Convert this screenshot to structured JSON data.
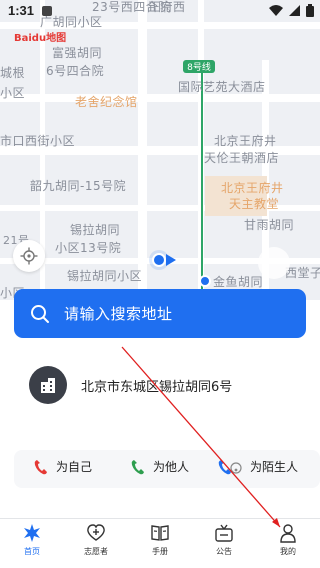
{
  "status_bar": {
    "time": "1:31"
  },
  "map": {
    "labels": {
      "l1": "23号西四合院",
      "l2": "正府西",
      "l3": "广胡同小区",
      "l4": "富强胡同",
      "l5": "6号四合院",
      "l6": "城根",
      "l7": "小区",
      "l8": "老舍纪念馆",
      "l9": "国际艺苑大酒店",
      "l10": "市口西街小区",
      "l11": "北京王府井",
      "l12": "天伦王朝酒店",
      "l13": "北京王府井",
      "l14": "天主教堂",
      "l15": "韶九胡同-15号院",
      "l16": "甘雨胡同",
      "l17": "锡拉胡同",
      "l18": "小区13号院",
      "l19": "锡拉胡同小区",
      "l20": "金鱼胡同",
      "l21": "西堂子",
      "l22": "21号",
      "l23": "小区"
    },
    "line_badge": "8号线",
    "brand": "Baidu地图"
  },
  "search": {
    "placeholder": "请输入搜索地址"
  },
  "address": {
    "text": "北京市东城区锡拉胡同6号"
  },
  "call_options": [
    {
      "label": "为自己"
    },
    {
      "label": "为他人"
    },
    {
      "label": "为陌生人"
    }
  ],
  "nav": [
    {
      "label": "首页"
    },
    {
      "label": "志愿者"
    },
    {
      "label": "手册"
    },
    {
      "label": "公告"
    },
    {
      "label": "我的"
    }
  ],
  "colors": {
    "accent": "#1f6ff0",
    "phone_red": "#e53935",
    "phone_green": "#2e9e4f",
    "metro_green": "#2ea567"
  }
}
